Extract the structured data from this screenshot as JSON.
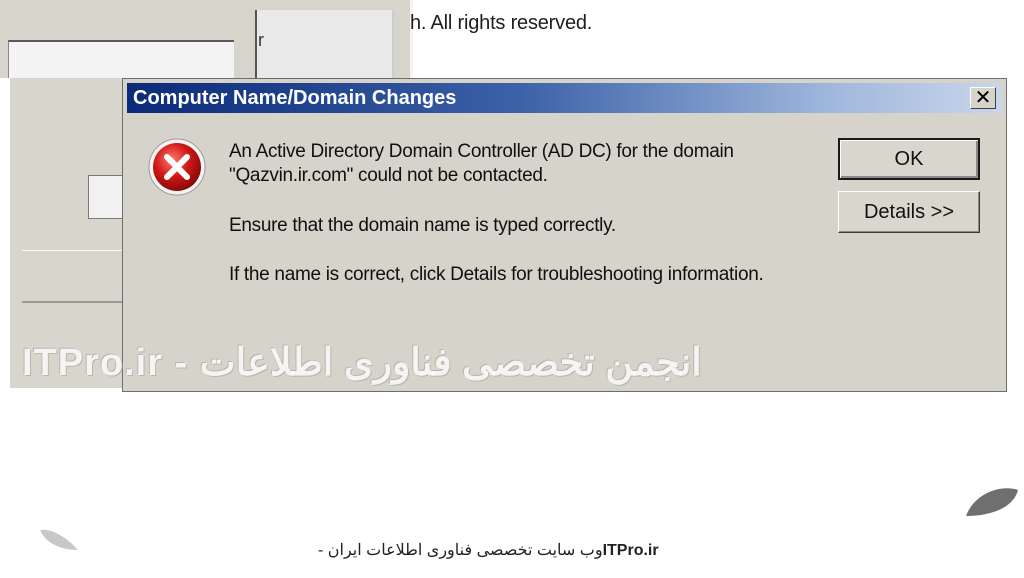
{
  "background": {
    "copyright_text": "h.  All rights reserved.",
    "inner_text": "r"
  },
  "dialog": {
    "title": "Computer Name/Domain Changes",
    "close_label": "✕",
    "message": {
      "line1": "An Active Directory Domain Controller (AD DC) for the domain",
      "line2": "\"Qazvin.ir.com\" could not be contacted.",
      "line3": "Ensure that the domain name is typed correctly.",
      "line4": "If the name is correct, click Details for troubleshooting information."
    },
    "buttons": {
      "ok": "OK",
      "details": "Details >>"
    },
    "icon": "error-icon"
  },
  "watermark": "ITPro.ir - انجمن تخصصی فناوری اطلاعات",
  "footer": {
    "brand": "ITPro.ir",
    "text": " - وب سایت تخصصی فناوری اطلاعات ایران"
  },
  "colors": {
    "titlebar_start": "#0b2a78",
    "titlebar_end": "#c9d6ea",
    "dialog_bg": "#d6d3ca",
    "error_red": "#d01818"
  }
}
